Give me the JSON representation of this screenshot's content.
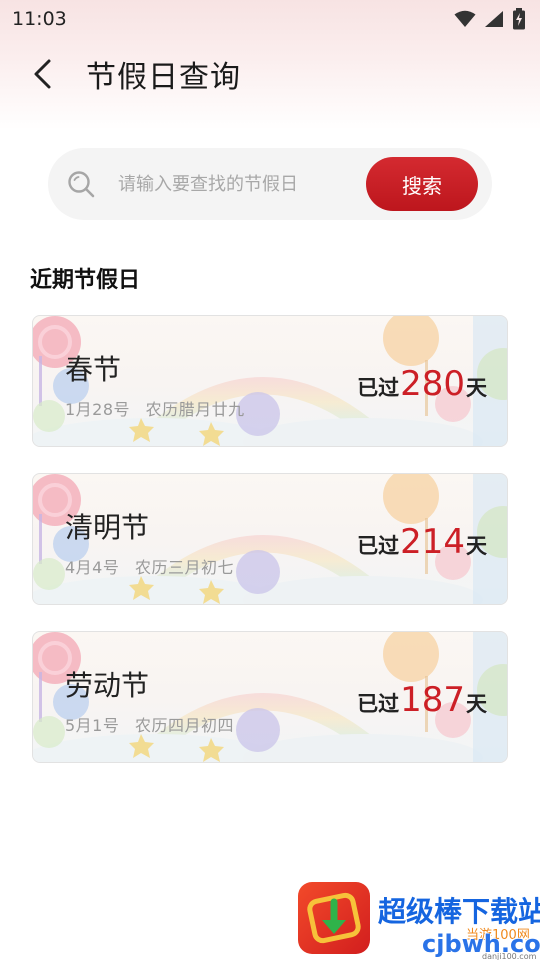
{
  "status_bar": {
    "time": "11:03",
    "icons": [
      "wifi-icon",
      "signal-icon",
      "battery-charging-icon"
    ]
  },
  "header": {
    "back_icon": "chevron-left-icon",
    "title": "节假日查询"
  },
  "search": {
    "placeholder": "请输入要查找的节假日",
    "value": "",
    "button_label": "搜索",
    "icon": "search-icon"
  },
  "section": {
    "title": "近期节假日"
  },
  "holidays": [
    {
      "name": "春节",
      "date": "1月28号",
      "lunar": "农历腊月廿九",
      "prefix": "已过",
      "days": "280",
      "suffix": "天"
    },
    {
      "name": "清明节",
      "date": "4月4号",
      "lunar": "农历三月初七",
      "prefix": "已过",
      "days": "214",
      "suffix": "天"
    },
    {
      "name": "劳动节",
      "date": "5月1号",
      "lunar": "农历四月初四",
      "prefix": "已过",
      "days": "187",
      "suffix": "天"
    }
  ],
  "watermark": {
    "title": "超级棒下载站",
    "sub": "当游100网",
    "url": "cjbwh.com",
    "url2": "danji100.com"
  },
  "colors": {
    "accent": "#c41a21",
    "days_number": "#cc1f26",
    "header_bg": "#f7e3e3",
    "search_bg": "#f4f4f4"
  }
}
